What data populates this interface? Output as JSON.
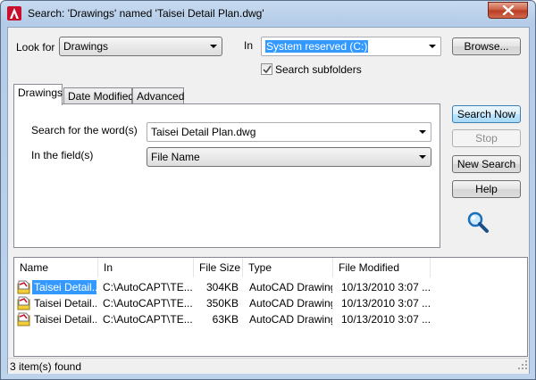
{
  "window": {
    "title": "Search: 'Drawings' named 'Taisei Detail Plan.dwg'"
  },
  "look_for": {
    "label": "Look for",
    "value": "Drawings"
  },
  "in_location": {
    "label": "In",
    "value": "System reserved (C:)"
  },
  "search_subfolders": {
    "label": "Search subfolders",
    "checked": true
  },
  "buttons": {
    "browse": "Browse...",
    "search_now": "Search Now",
    "stop": "Stop",
    "new_search": "New Search",
    "help": "Help"
  },
  "tabs": [
    {
      "label": "Drawings",
      "active": true
    },
    {
      "label": "Date Modified",
      "active": false
    },
    {
      "label": "Advanced",
      "active": false
    }
  ],
  "drawings_tab": {
    "search_words_label": "Search for the word(s)",
    "search_words_value": "Taisei Detail Plan.dwg",
    "in_fields_label": "In the field(s)",
    "in_fields_value": "File Name"
  },
  "results": {
    "columns": [
      "Name",
      "In",
      "File Size",
      "Type",
      "File Modified"
    ],
    "rows": [
      {
        "name": "Taisei Detail...",
        "in": "C:\\AutoCAPT\\TE...",
        "size": "304KB",
        "type": "AutoCAD Drawing",
        "modified": "10/13/2010 3:07 ..."
      },
      {
        "name": "Taisei Detail...",
        "in": "C:\\AutoCAPT\\TE...",
        "size": "350KB",
        "type": "AutoCAD Drawing",
        "modified": "10/13/2010 3:07 ..."
      },
      {
        "name": "Taisei Detail...",
        "in": "C:\\AutoCAPT\\TE...",
        "size": "63KB",
        "type": "AutoCAD Drawing",
        "modified": "10/13/2010 3:07 ..."
      }
    ]
  },
  "status": {
    "text": "3 item(s) found"
  },
  "colors": {
    "accent": "#3399ff",
    "autocad_red": "#c8102e"
  },
  "icons": {
    "app": "autocad-logo-icon",
    "close": "close-icon",
    "search": "magnifier-icon",
    "file": "dwg-file-icon"
  }
}
